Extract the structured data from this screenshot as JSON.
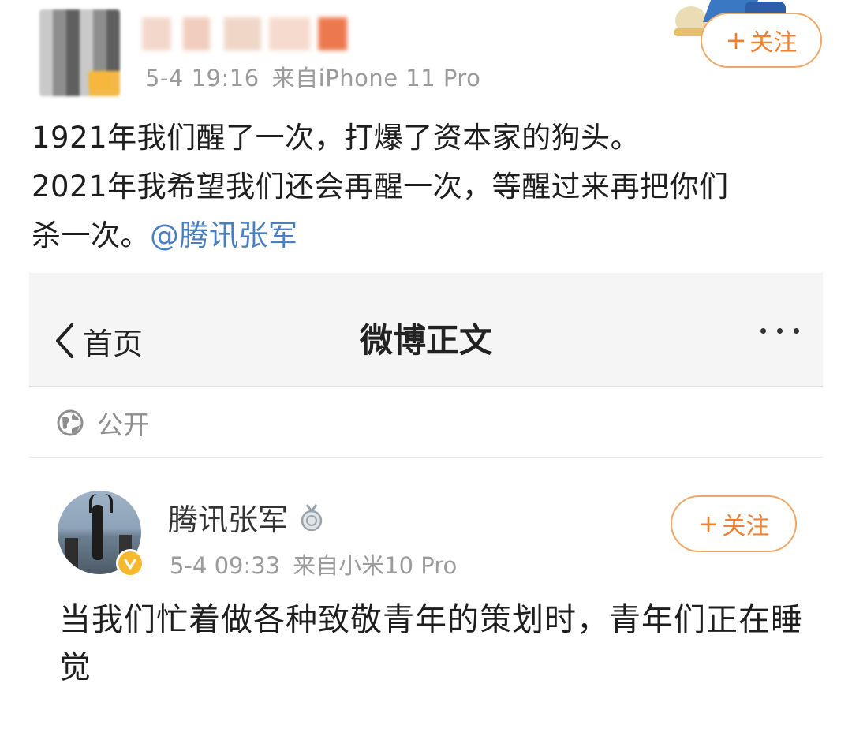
{
  "outer_post": {
    "timestamp": "5-4 19:16",
    "source": "来自iPhone 11 Pro",
    "follow_label": "关注",
    "text_lines": [
      "1921年我们醒了一次，打爆了资本家的狗头。",
      "2021年我希望我们还会再醒一次，等醒过来再把你们",
      "杀一次。"
    ],
    "mention": "@腾讯张军"
  },
  "embedded": {
    "nav": {
      "back_label": "首页",
      "title": "微博正文"
    },
    "visibility": "公开",
    "post": {
      "author": "腾讯张军",
      "timestamp": "5-4 09:33",
      "source": "来自小米10 Pro",
      "follow_label": "关注",
      "text": "当我们忙着做各种致敬青年的策划时，青年们正在睡觉"
    }
  },
  "icons": {
    "back": "chevron-left-icon",
    "more": "more-dots-icon",
    "visibility": "globe-icon",
    "verified": "verified-v-icon",
    "medal": "medal-icon",
    "plus": "plus-icon"
  },
  "colors": {
    "accent_orange": "#f08030",
    "mention_blue": "#4a7fbf",
    "meta_gray": "#9b9b9b",
    "verified_gold": "#f7b82e"
  }
}
